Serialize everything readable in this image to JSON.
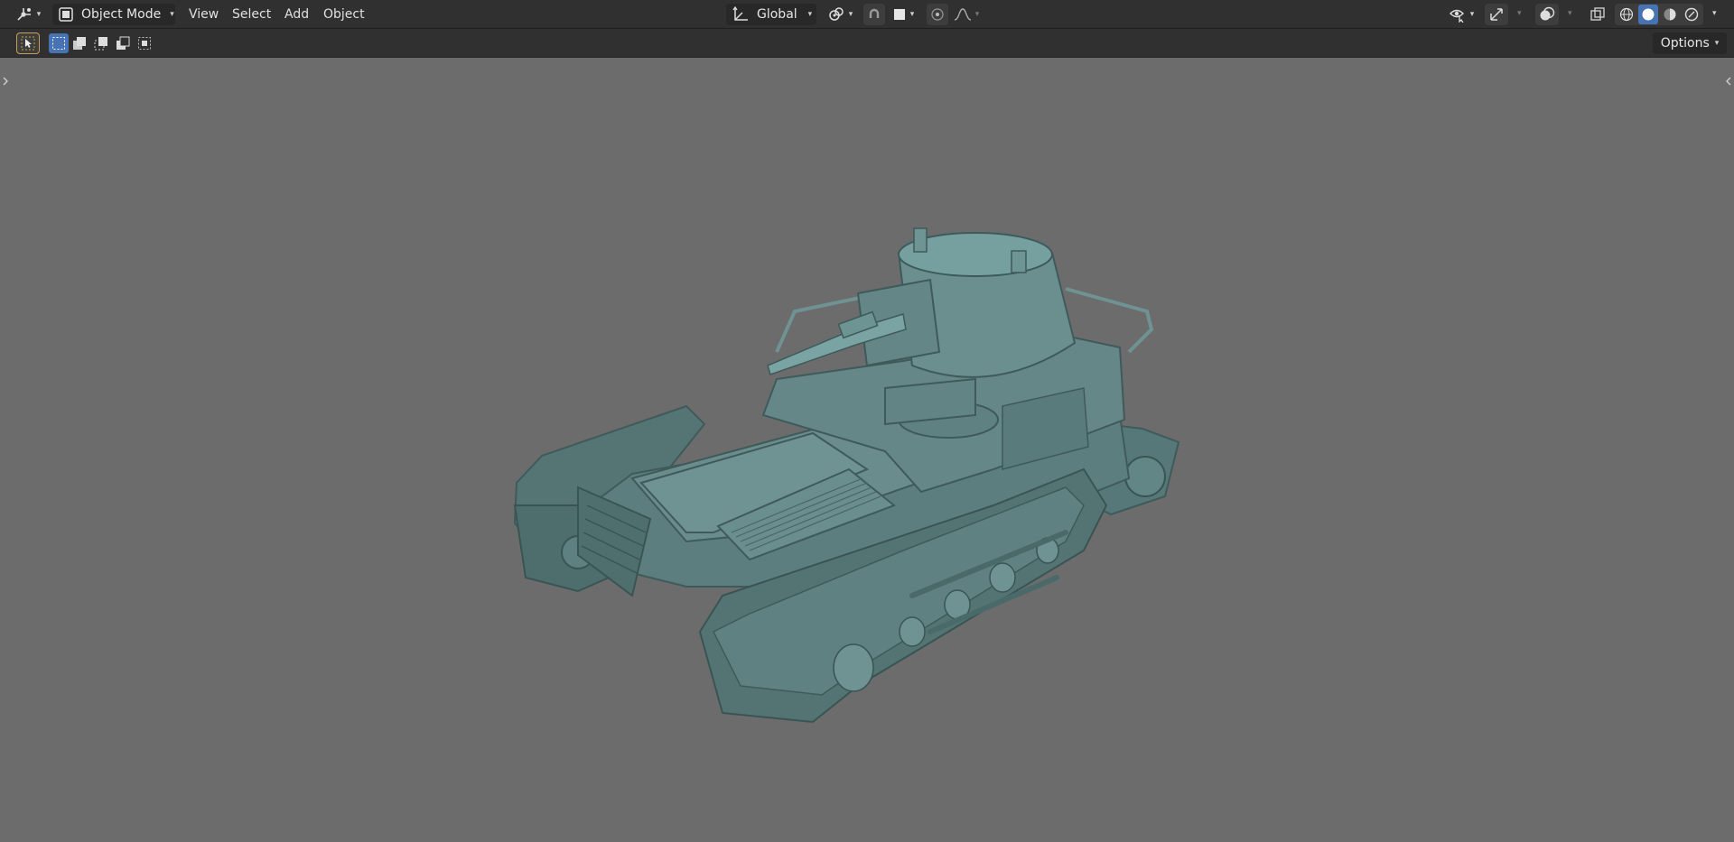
{
  "header": {
    "editor_type_icon": "viewport-3d-icon",
    "mode_label": "Object Mode",
    "menus": [
      "View",
      "Select",
      "Add",
      "Object"
    ],
    "transform_orientation": "Global"
  },
  "toolbar2": {
    "options_label": "Options"
  },
  "colors": {
    "header_bg": "#303030",
    "viewport_bg": "#6c6c6c",
    "accent": "#4772b3",
    "model_color": "#5b7b7b"
  }
}
